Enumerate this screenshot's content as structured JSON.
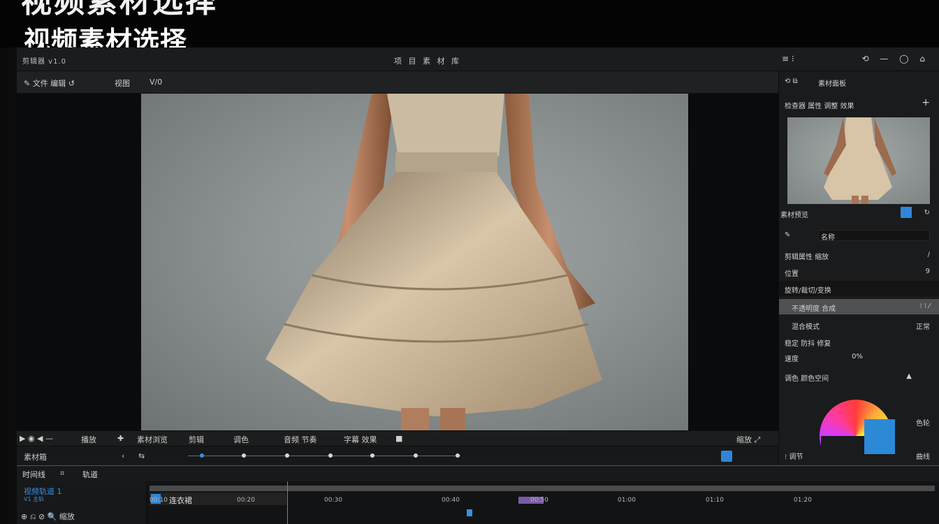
{
  "caption": {
    "title_cut": "视频素材选择",
    "title": "视频素材选择"
  },
  "menubar": {
    "left": "剪辑器 v1.0",
    "center": "项 目 素 材 库",
    "right": "≡ ⁝",
    "right_icons": "⟲ — ◯ ⌂"
  },
  "toolbar": {
    "items": [
      "✎ 文件 编辑 ↺",
      "视图",
      "V/0"
    ]
  },
  "playbar": {
    "items": [
      "▶ ◉ ◀ —",
      "播放",
      "✚",
      "素材浏览",
      "剪辑",
      "调色",
      "音频 节奏",
      "字幕 效果",
      "■",
      "缩放 ⤢"
    ]
  },
  "scrubrow": {
    "left": "素材箱",
    "arrow": "‹",
    "icon": "⇆"
  },
  "inspector": {
    "header": "素材面板",
    "panel_title": "检查器 属性 调整 效果",
    "plus": "+",
    "thumb_label": "素材预览",
    "rows": [
      {
        "l": "✎",
        "r": "名称"
      },
      {
        "l": "剪辑属性 缩放",
        "r": "/"
      },
      {
        "l": "位置",
        "r": "9"
      },
      {
        "l": "旋转/裁切/变换",
        "r": ""
      },
      {
        "l": "不透明度 合成",
        "r": "⁝ ⁝ ⁄"
      },
      {
        "l": "混合模式",
        "r": "正常"
      },
      {
        "l": "稳定 防抖 修复",
        "r": ""
      },
      {
        "l": "速度",
        "r": "0%"
      },
      {
        "l": "调色 颜色空间",
        "r": "▲"
      }
    ],
    "wheel_left": "⁝ 调节",
    "wheel_right_top": "色轮",
    "wheel_right_bottom": "曲线"
  },
  "timeline": {
    "head_items": [
      "时间线",
      "⌗",
      "轨道"
    ],
    "track_name": "视频轨道 1",
    "track_sub": "V1 主轨",
    "clip_label": "连衣裙",
    "bottom_tools": "⊕ ⎌ ⊘ 🔍 缩放",
    "ticks": [
      "00:10",
      "00:20",
      "00:30",
      "00:40",
      "00:50",
      "01:00",
      "01:10",
      "01:20"
    ]
  }
}
